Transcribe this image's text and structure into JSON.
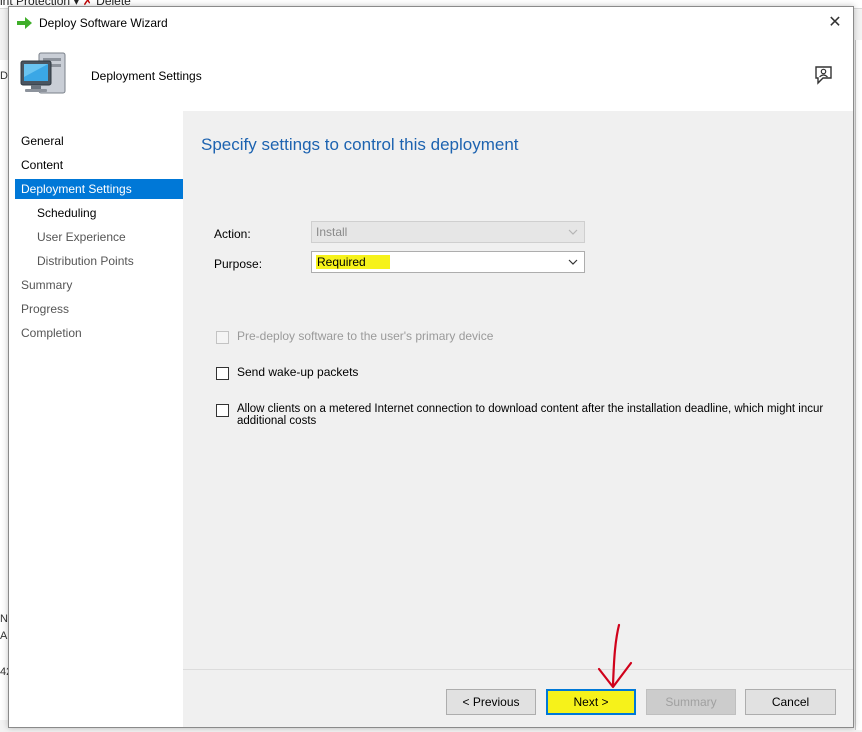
{
  "background": {
    "top_text": "int Protection",
    "top_delete": "Delete",
    "left_edge_texts": [
      "D",
      "N",
      "A",
      "42"
    ]
  },
  "window": {
    "title": "Deploy Software Wizard",
    "close_glyph": "✕"
  },
  "header": {
    "title": "Deployment Settings"
  },
  "nav": {
    "items": [
      {
        "label": "General",
        "state": "normal"
      },
      {
        "label": "Content",
        "state": "normal"
      },
      {
        "label": "Deployment Settings",
        "state": "active"
      },
      {
        "label": "Scheduling",
        "state": "sub"
      },
      {
        "label": "User Experience",
        "state": "sub-dim"
      },
      {
        "label": "Distribution Points",
        "state": "sub-dim"
      },
      {
        "label": "Summary",
        "state": "dim"
      },
      {
        "label": "Progress",
        "state": "dim"
      },
      {
        "label": "Completion",
        "state": "dim"
      }
    ]
  },
  "main": {
    "title": "Specify settings to control this deployment",
    "action": {
      "label": "Action:",
      "value": "Install",
      "enabled": false
    },
    "purpose": {
      "label": "Purpose:",
      "value": "Required",
      "enabled": true,
      "highlighted": true
    },
    "options": [
      {
        "label": "Pre-deploy software to the user's primary device",
        "checked": false,
        "enabled": false
      },
      {
        "label": "Send wake-up packets",
        "checked": false,
        "enabled": true
      },
      {
        "label": "Allow clients on a metered Internet connection to download content after the installation deadline, which might incur additional costs",
        "checked": false,
        "enabled": true
      }
    ]
  },
  "footer": {
    "previous": "< Previous",
    "next": "Next >",
    "summary": "Summary",
    "cancel": "Cancel"
  },
  "colors": {
    "accent": "#0078d7",
    "title_blue": "#1d63b0",
    "highlight": "#f6f21a",
    "annotation_red": "#d0021b"
  }
}
